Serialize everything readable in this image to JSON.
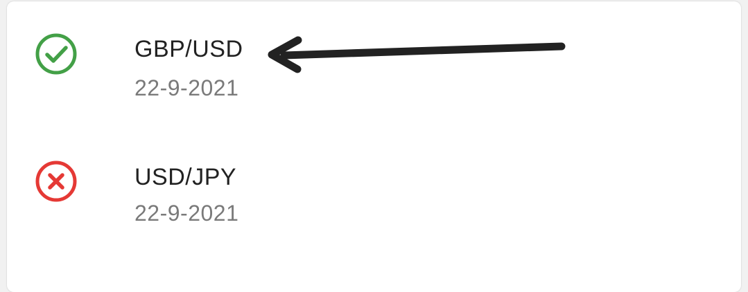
{
  "trades": [
    {
      "status": "success",
      "status_icon": "check-circle-icon",
      "status_color": "#43a047",
      "pair": "GBP/USD",
      "date": "22-9-2021"
    },
    {
      "status": "failure",
      "status_icon": "x-circle-icon",
      "status_color": "#e53935",
      "pair": "USD/JPY",
      "date": "22-9-2021"
    }
  ],
  "annotation": {
    "icon": "arrow-left-icon",
    "color": "#222222"
  }
}
